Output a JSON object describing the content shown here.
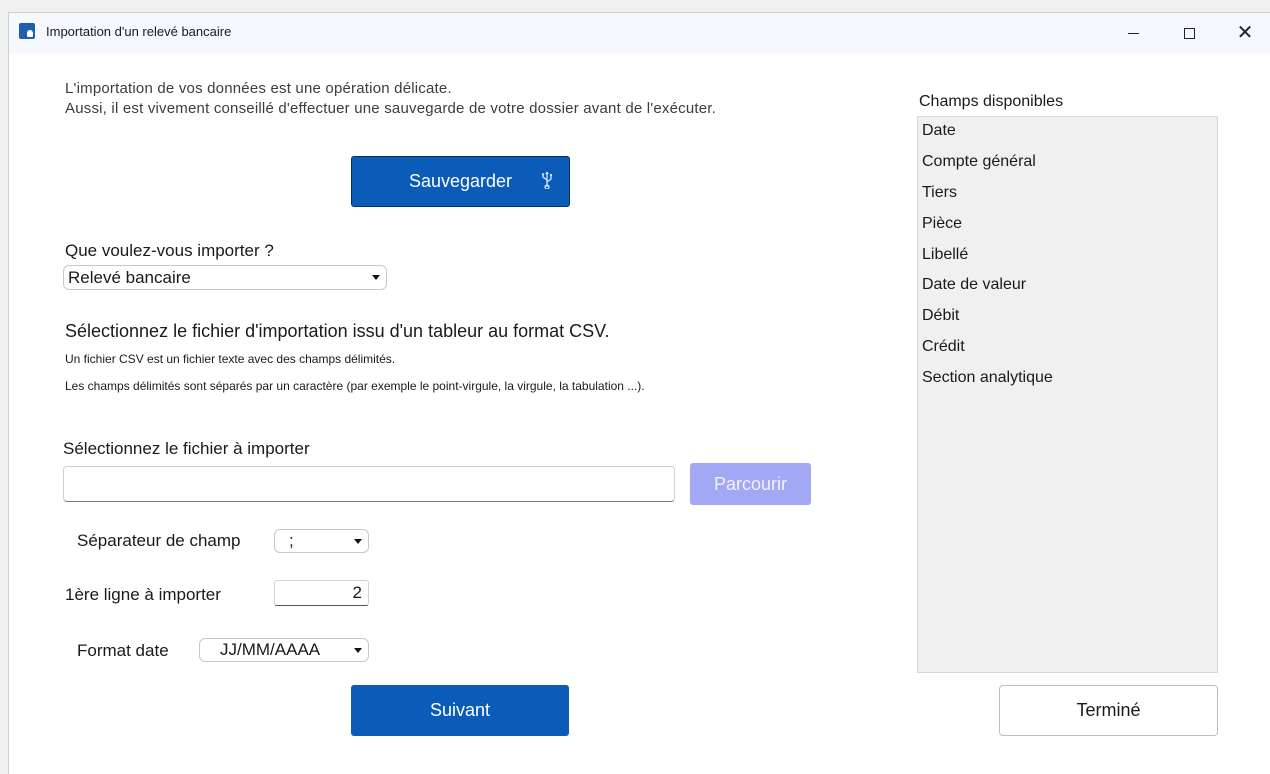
{
  "window": {
    "title": "Importation d'un relevé bancaire",
    "icon": "bank-app-icon",
    "controls": {
      "minimize": "minimize-icon",
      "maximize": "maximize-icon",
      "close": "close-icon",
      "close_glyph": "✕"
    }
  },
  "intro": {
    "line1": "L'importation de vos données est une opération délicate.",
    "line2": "Aussi, il est vivement conseillé d'effectuer une sauvegarde de votre dossier avant de l'exécuter."
  },
  "save_button": {
    "label": "Sauvegarder",
    "icon": "usb-icon",
    "icon_glyph": "⚲"
  },
  "import_type": {
    "question": "Que voulez-vous importer ?",
    "selected": "Relevé bancaire"
  },
  "csv_info": {
    "heading": "Sélectionnez le fichier d'importation issu d'un tableur au format CSV.",
    "note1": "Un fichier CSV est un fichier texte avec des champs délimités.",
    "note2": "Les champs délimités sont séparés par un caractère (par exemple le point-virgule, la virgule, la tabulation ...)."
  },
  "file": {
    "label": "Sélectionnez le fichier à importer",
    "value": "",
    "browse_label": "Parcourir"
  },
  "options": {
    "separator_label": "Séparateur de champ",
    "separator_value": ";",
    "first_line_label": "1ère ligne à importer",
    "first_line_value": "2",
    "date_format_label": "Format date",
    "date_format_value": "JJ/MM/AAAA"
  },
  "next_button": {
    "label": "Suivant"
  },
  "fields": {
    "title": "Champs disponibles",
    "items": [
      "Date",
      "Compte général",
      "Tiers",
      "Pièce",
      "Libellé",
      "Date de valeur",
      "Débit",
      "Crédit",
      "Section analytique"
    ]
  },
  "done_button": {
    "label": "Terminé"
  },
  "colors": {
    "primary": "#0b5cb8",
    "disabled_button": "#a3a8f5",
    "list_background": "#f0f0f0"
  }
}
